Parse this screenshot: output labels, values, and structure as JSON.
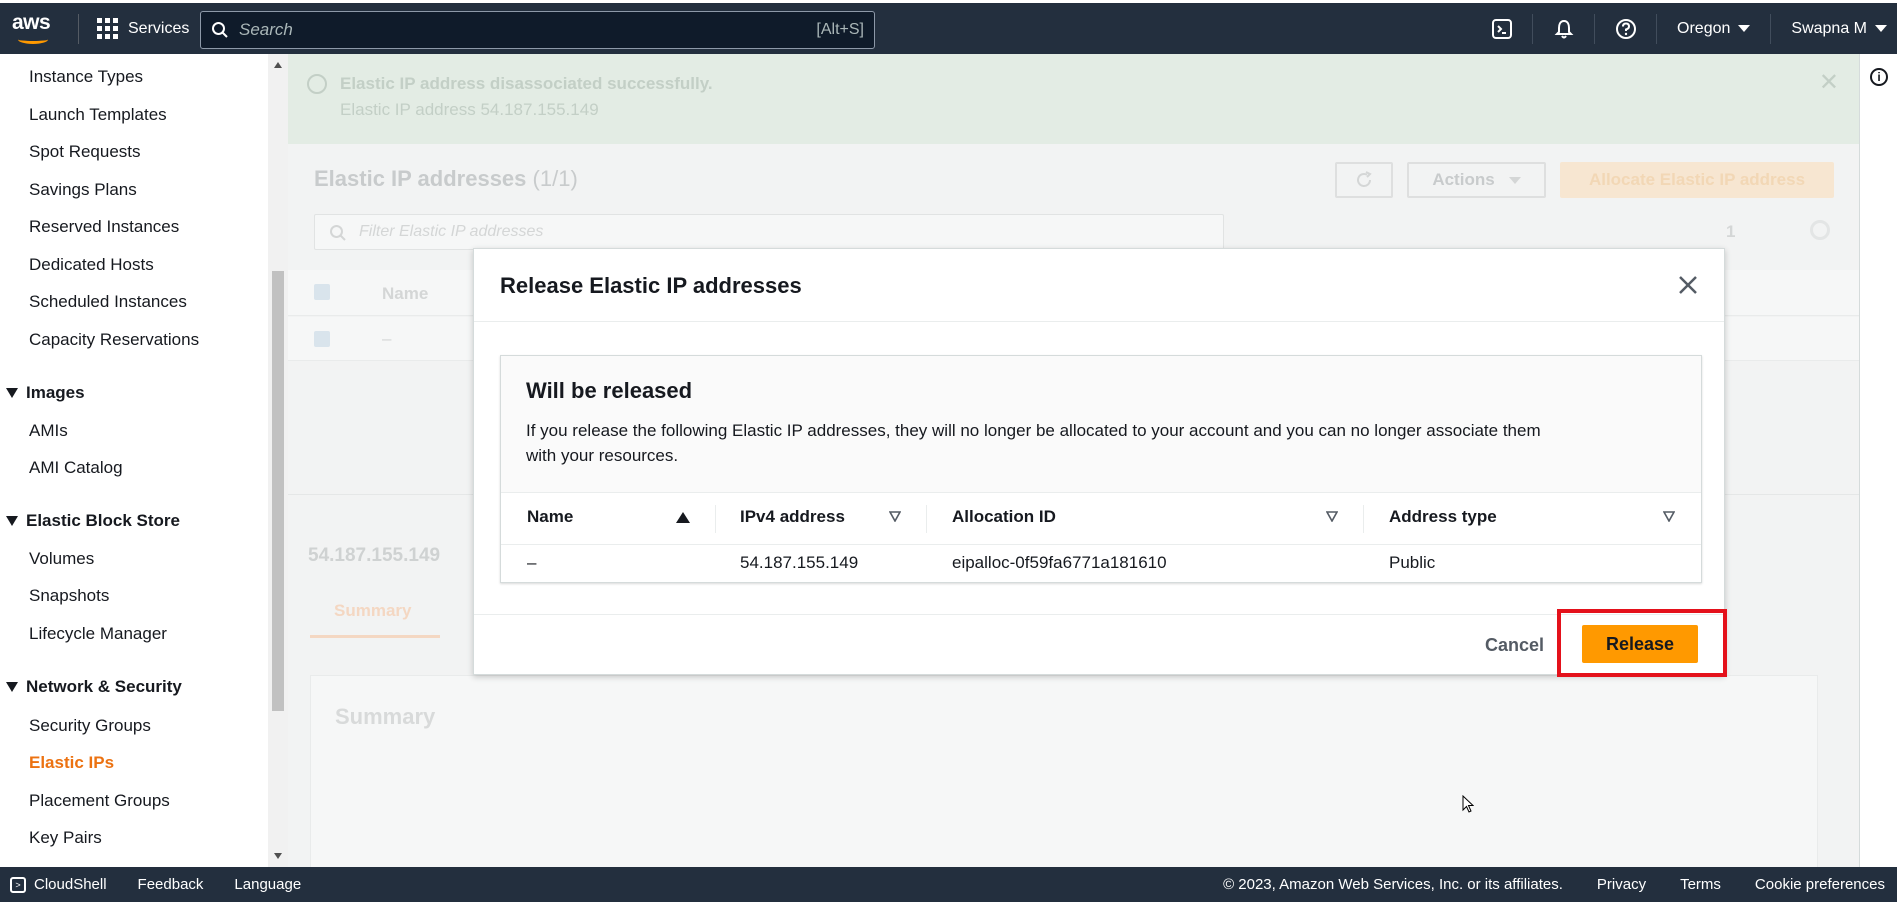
{
  "topnav": {
    "logo": "aws",
    "services_label": "Services",
    "search_placeholder": "Search",
    "search_shortcut": "[Alt+S]",
    "region": "Oregon",
    "user": "Swapna M",
    "icons": [
      "cloudshell-icon",
      "bell-icon",
      "help-icon"
    ]
  },
  "sidebar": {
    "items_top": [
      "Instance Types",
      "Launch Templates",
      "Spot Requests",
      "Savings Plans",
      "Reserved Instances",
      "Dedicated Hosts",
      "Scheduled Instances",
      "Capacity Reservations"
    ],
    "images_head": "Images",
    "images_items": [
      "AMIs",
      "AMI Catalog"
    ],
    "ebs_head": "Elastic Block Store",
    "ebs_items": [
      "Volumes",
      "Snapshots",
      "Lifecycle Manager"
    ],
    "network_head": "Network & Security",
    "network_items": [
      "Security Groups",
      "Elastic IPs",
      "Placement Groups",
      "Key Pairs"
    ],
    "active_item": "Elastic IPs"
  },
  "background": {
    "flash_title": "Elastic IP address disassociated successfully.",
    "flash_detail": "Elastic IP address 54.187.155.149",
    "page_title": "Elastic IP addresses",
    "page_count": "(1/1)",
    "actions_label": "Actions",
    "allocate_label": "Allocate Elastic IP address",
    "filter_placeholder": "Filter Elastic IP addresses",
    "page_number": "1",
    "col_name": "Name",
    "row_dash": "–",
    "selected_ip": "54.187.155.149",
    "tab_summary": "Summary",
    "summary_heading": "Summary"
  },
  "modal": {
    "title": "Release Elastic IP addresses",
    "panel_title": "Will be released",
    "panel_desc": "If you release the following Elastic IP addresses, they will no longer be allocated to your account and you can no longer associate them with your resources.",
    "columns": [
      "Name",
      "IPv4 address",
      "Allocation ID",
      "Address type"
    ],
    "row": {
      "name": "–",
      "ipv4": "54.187.155.149",
      "allocation_id": "eipalloc-0f59fa6771a181610",
      "address_type": "Public"
    },
    "cancel_label": "Cancel",
    "release_label": "Release"
  },
  "footer": {
    "cloudshell": "CloudShell",
    "feedback": "Feedback",
    "language": "Language",
    "copyright": "© 2023, Amazon Web Services, Inc. or its affiliates.",
    "privacy": "Privacy",
    "terms": "Terms",
    "cookies": "Cookie preferences"
  },
  "colors": {
    "nav_bg": "#232f3e",
    "accent": "#ff9900",
    "active_link": "#ec7211",
    "highlight_box": "#e4111b"
  }
}
